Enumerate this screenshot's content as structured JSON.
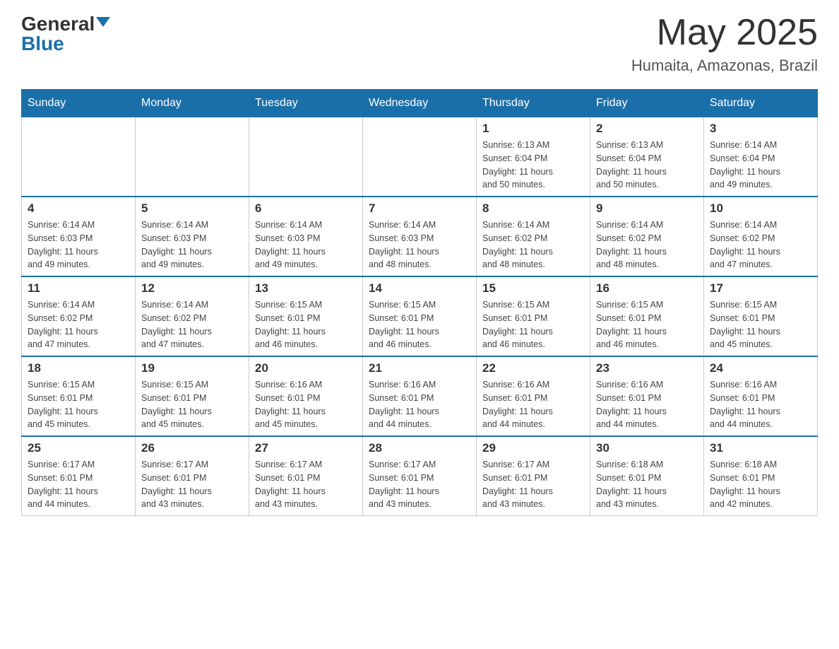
{
  "header": {
    "logo_general": "General",
    "logo_blue": "Blue",
    "month_title": "May 2025",
    "location": "Humaita, Amazonas, Brazil"
  },
  "weekdays": [
    "Sunday",
    "Monday",
    "Tuesday",
    "Wednesday",
    "Thursday",
    "Friday",
    "Saturday"
  ],
  "weeks": [
    [
      {
        "day": "",
        "info": ""
      },
      {
        "day": "",
        "info": ""
      },
      {
        "day": "",
        "info": ""
      },
      {
        "day": "",
        "info": ""
      },
      {
        "day": "1",
        "info": "Sunrise: 6:13 AM\nSunset: 6:04 PM\nDaylight: 11 hours\nand 50 minutes."
      },
      {
        "day": "2",
        "info": "Sunrise: 6:13 AM\nSunset: 6:04 PM\nDaylight: 11 hours\nand 50 minutes."
      },
      {
        "day": "3",
        "info": "Sunrise: 6:14 AM\nSunset: 6:04 PM\nDaylight: 11 hours\nand 49 minutes."
      }
    ],
    [
      {
        "day": "4",
        "info": "Sunrise: 6:14 AM\nSunset: 6:03 PM\nDaylight: 11 hours\nand 49 minutes."
      },
      {
        "day": "5",
        "info": "Sunrise: 6:14 AM\nSunset: 6:03 PM\nDaylight: 11 hours\nand 49 minutes."
      },
      {
        "day": "6",
        "info": "Sunrise: 6:14 AM\nSunset: 6:03 PM\nDaylight: 11 hours\nand 49 minutes."
      },
      {
        "day": "7",
        "info": "Sunrise: 6:14 AM\nSunset: 6:03 PM\nDaylight: 11 hours\nand 48 minutes."
      },
      {
        "day": "8",
        "info": "Sunrise: 6:14 AM\nSunset: 6:02 PM\nDaylight: 11 hours\nand 48 minutes."
      },
      {
        "day": "9",
        "info": "Sunrise: 6:14 AM\nSunset: 6:02 PM\nDaylight: 11 hours\nand 48 minutes."
      },
      {
        "day": "10",
        "info": "Sunrise: 6:14 AM\nSunset: 6:02 PM\nDaylight: 11 hours\nand 47 minutes."
      }
    ],
    [
      {
        "day": "11",
        "info": "Sunrise: 6:14 AM\nSunset: 6:02 PM\nDaylight: 11 hours\nand 47 minutes."
      },
      {
        "day": "12",
        "info": "Sunrise: 6:14 AM\nSunset: 6:02 PM\nDaylight: 11 hours\nand 47 minutes."
      },
      {
        "day": "13",
        "info": "Sunrise: 6:15 AM\nSunset: 6:01 PM\nDaylight: 11 hours\nand 46 minutes."
      },
      {
        "day": "14",
        "info": "Sunrise: 6:15 AM\nSunset: 6:01 PM\nDaylight: 11 hours\nand 46 minutes."
      },
      {
        "day": "15",
        "info": "Sunrise: 6:15 AM\nSunset: 6:01 PM\nDaylight: 11 hours\nand 46 minutes."
      },
      {
        "day": "16",
        "info": "Sunrise: 6:15 AM\nSunset: 6:01 PM\nDaylight: 11 hours\nand 46 minutes."
      },
      {
        "day": "17",
        "info": "Sunrise: 6:15 AM\nSunset: 6:01 PM\nDaylight: 11 hours\nand 45 minutes."
      }
    ],
    [
      {
        "day": "18",
        "info": "Sunrise: 6:15 AM\nSunset: 6:01 PM\nDaylight: 11 hours\nand 45 minutes."
      },
      {
        "day": "19",
        "info": "Sunrise: 6:15 AM\nSunset: 6:01 PM\nDaylight: 11 hours\nand 45 minutes."
      },
      {
        "day": "20",
        "info": "Sunrise: 6:16 AM\nSunset: 6:01 PM\nDaylight: 11 hours\nand 45 minutes."
      },
      {
        "day": "21",
        "info": "Sunrise: 6:16 AM\nSunset: 6:01 PM\nDaylight: 11 hours\nand 44 minutes."
      },
      {
        "day": "22",
        "info": "Sunrise: 6:16 AM\nSunset: 6:01 PM\nDaylight: 11 hours\nand 44 minutes."
      },
      {
        "day": "23",
        "info": "Sunrise: 6:16 AM\nSunset: 6:01 PM\nDaylight: 11 hours\nand 44 minutes."
      },
      {
        "day": "24",
        "info": "Sunrise: 6:16 AM\nSunset: 6:01 PM\nDaylight: 11 hours\nand 44 minutes."
      }
    ],
    [
      {
        "day": "25",
        "info": "Sunrise: 6:17 AM\nSunset: 6:01 PM\nDaylight: 11 hours\nand 44 minutes."
      },
      {
        "day": "26",
        "info": "Sunrise: 6:17 AM\nSunset: 6:01 PM\nDaylight: 11 hours\nand 43 minutes."
      },
      {
        "day": "27",
        "info": "Sunrise: 6:17 AM\nSunset: 6:01 PM\nDaylight: 11 hours\nand 43 minutes."
      },
      {
        "day": "28",
        "info": "Sunrise: 6:17 AM\nSunset: 6:01 PM\nDaylight: 11 hours\nand 43 minutes."
      },
      {
        "day": "29",
        "info": "Sunrise: 6:17 AM\nSunset: 6:01 PM\nDaylight: 11 hours\nand 43 minutes."
      },
      {
        "day": "30",
        "info": "Sunrise: 6:18 AM\nSunset: 6:01 PM\nDaylight: 11 hours\nand 43 minutes."
      },
      {
        "day": "31",
        "info": "Sunrise: 6:18 AM\nSunset: 6:01 PM\nDaylight: 11 hours\nand 42 minutes."
      }
    ]
  ]
}
